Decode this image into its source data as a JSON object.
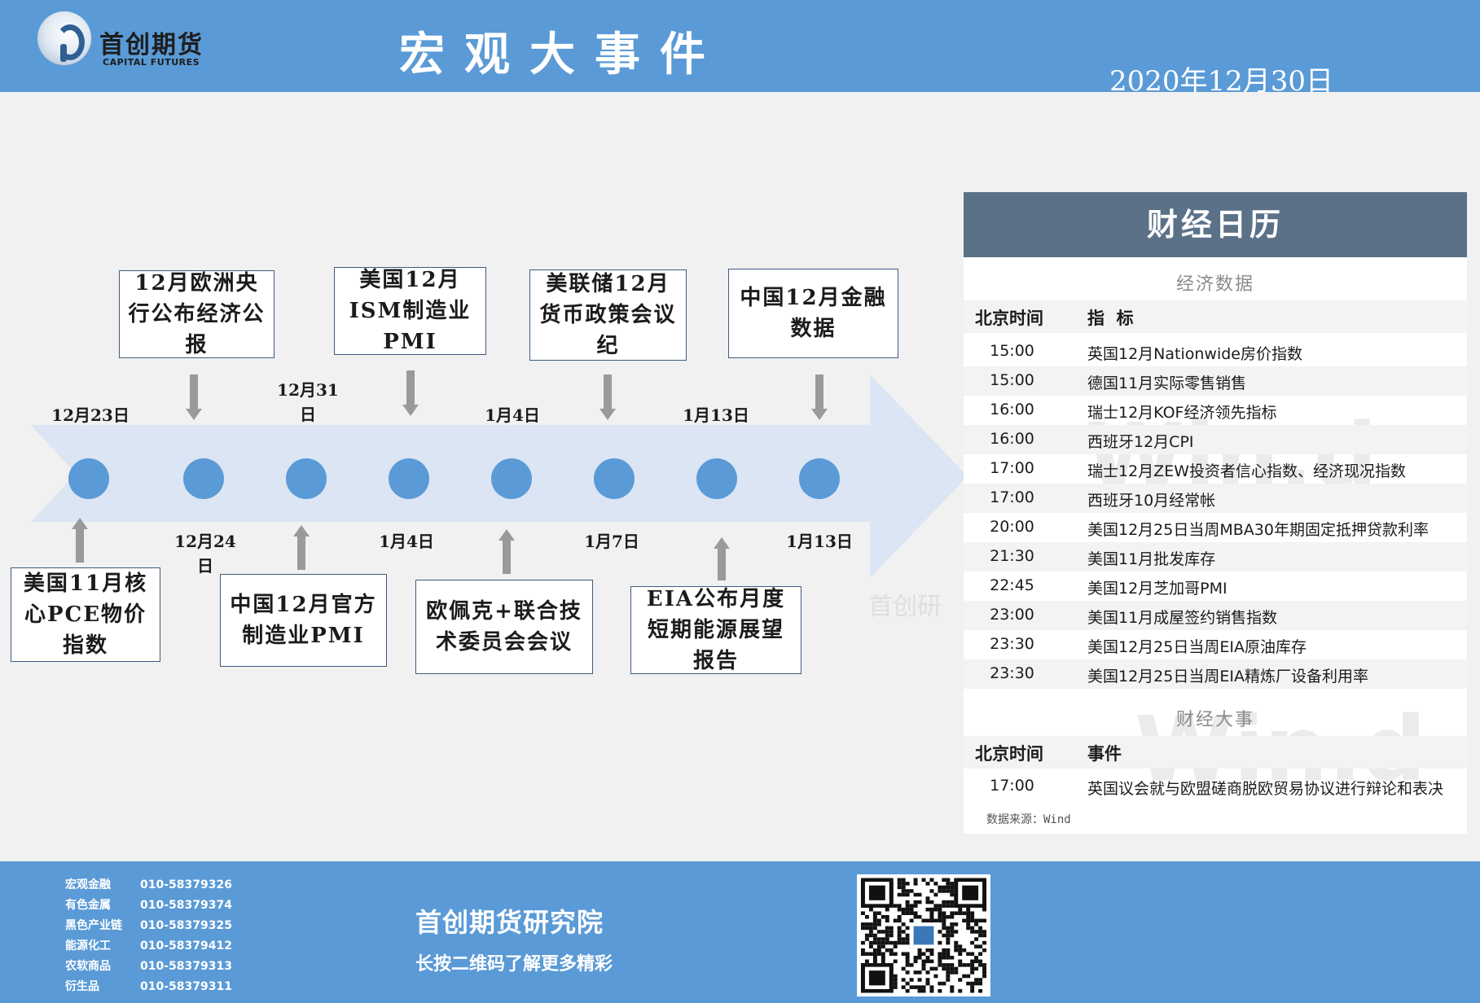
{
  "header": {
    "logo_cn": "首创期货",
    "logo_en": "CAPITAL FUTURES",
    "title": "宏观大事件",
    "date": "2020年12月30日"
  },
  "timeline": {
    "top_dates": [
      "12月23日",
      "12月31日",
      "1月4日",
      "1月13日"
    ],
    "bottom_dates": [
      "12月24日",
      "1月4日",
      "1月7日",
      "1月13日"
    ],
    "top_events": [
      "12月欧洲央行公布经济公报",
      "美国12月ISM制造业PMI",
      "美联储12月货币政策会议纪",
      "中国12月金融数据"
    ],
    "bottom_events": [
      "美国11月核心PCE物价指数",
      "中国12月官方制造业PMI",
      "欧佩克+联合技术委员会会议",
      "EIA公布月度短期能源展望报告"
    ]
  },
  "calendar": {
    "title": "财经日历",
    "econ_section": "经济数据",
    "col_time": "北京时间",
    "col_indicator": "指  标",
    "rows": [
      {
        "time": "15:00",
        "item": "英国12月Nationwide房价指数"
      },
      {
        "time": "15:00",
        "item": "德国11月实际零售销售"
      },
      {
        "time": "16:00",
        "item": "瑞士12月KOF经济领先指标"
      },
      {
        "time": "16:00",
        "item": "西班牙12月CPI"
      },
      {
        "time": "17:00",
        "item": "瑞士12月ZEW投资者信心指数、经济现况指数"
      },
      {
        "time": "17:00",
        "item": "西班牙10月经常帐"
      },
      {
        "time": "20:00",
        "item": "美国12月25日当周MBA30年期固定抵押贷款利率"
      },
      {
        "time": "21:30",
        "item": "美国11月批发库存"
      },
      {
        "time": "22:45",
        "item": "美国12月芝加哥PMI"
      },
      {
        "time": "23:00",
        "item": "美国11月成屋签约销售指数"
      },
      {
        "time": "23:30",
        "item": "美国12月25日当周EIA原油库存"
      },
      {
        "time": "23:30",
        "item": "美国12月25日当周EIA精炼厂设备利用率"
      }
    ],
    "events_section": "财经大事",
    "col_event": "事件",
    "event_rows": [
      {
        "time": "17:00",
        "item": "英国议会就与欧盟磋商脱欧贸易协议进行辩论和表决"
      }
    ],
    "source": "数据来源：Wind"
  },
  "watermarks": {
    "wind": "Win.d",
    "shouchuang": "首创研"
  },
  "footer": {
    "contacts": [
      {
        "name": "宏观金融",
        "phone": "010-58379326"
      },
      {
        "name": "有色金属",
        "phone": "010-58379374"
      },
      {
        "name": "黑色产业链",
        "phone": "010-58379325"
      },
      {
        "name": "能源化工",
        "phone": "010-58379412"
      },
      {
        "name": "农软商品",
        "phone": "010-58379313"
      },
      {
        "name": "衍生品",
        "phone": "010-58379311"
      }
    ],
    "title": "首创期货研究院",
    "subtitle": "长按二维码了解更多精彩"
  },
  "colors": {
    "header_blue": "#5a9ad6",
    "calendar_head": "#5b7188",
    "arrow_fill": "#dbe5f3",
    "dot": "#5a9ad6"
  }
}
